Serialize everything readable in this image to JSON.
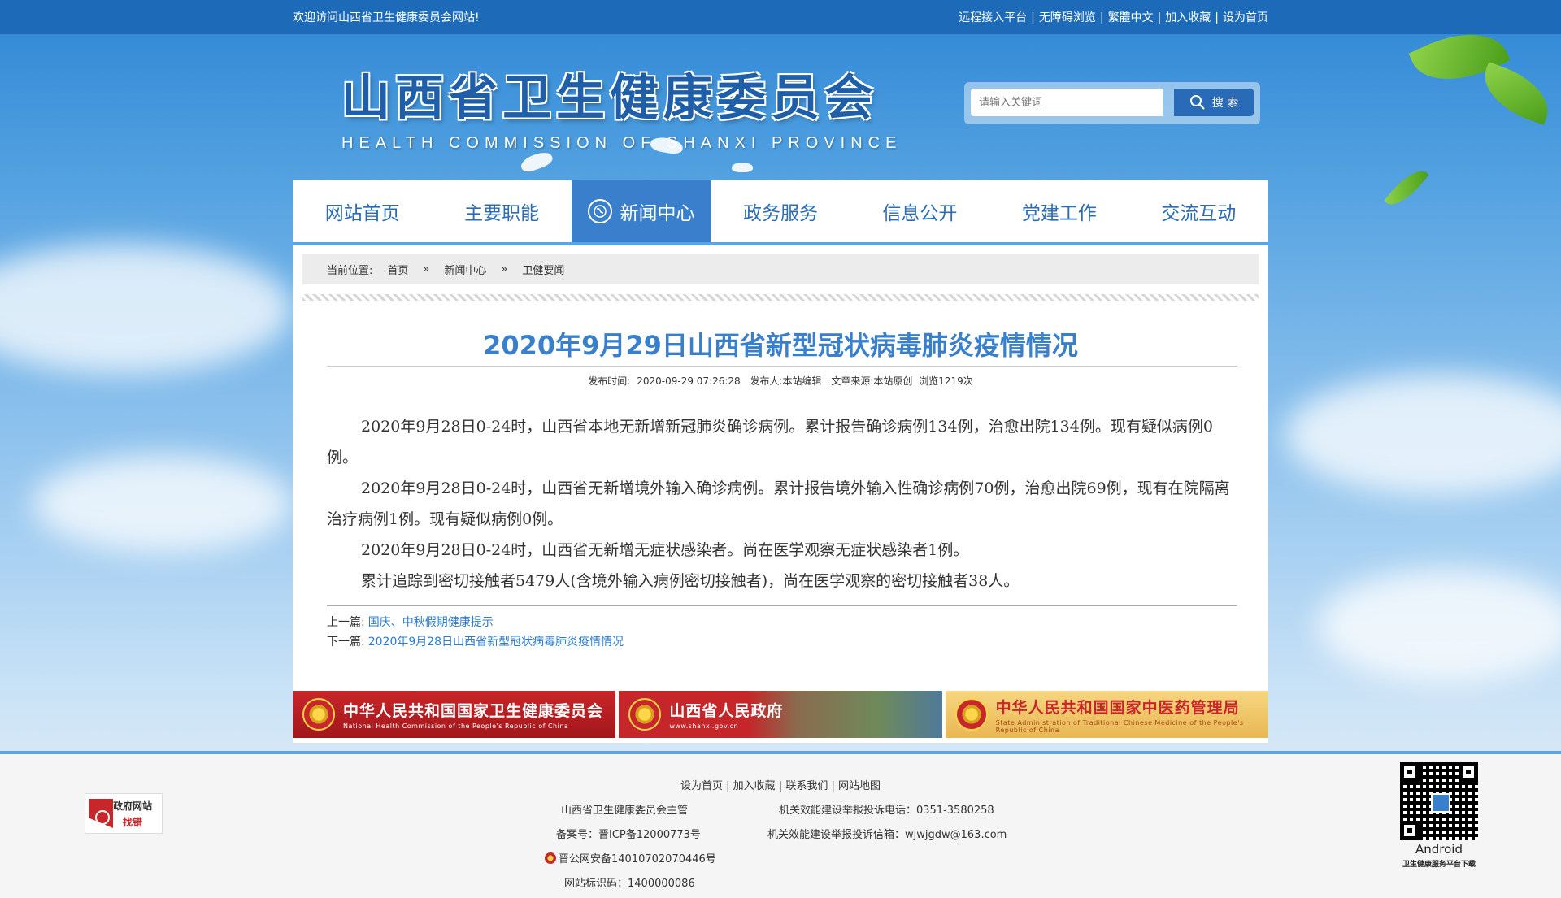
{
  "topbar": {
    "welcome": "欢迎访问山西省卫生健康委员会网站!",
    "links": [
      "远程接入平台",
      "无障碍浏览",
      "繁體中文",
      "加入收藏",
      "设为首页"
    ]
  },
  "logo": {
    "cn": "山西省卫生健康委员会",
    "en": "HEALTH COMMISSION OF SHANXI PROVINCE"
  },
  "search": {
    "placeholder": "请输入关键词",
    "button": "搜 索",
    "icon": "search-icon"
  },
  "nav": {
    "items": [
      "网站首页",
      "主要职能",
      "新闻中心",
      "政务服务",
      "信息公开",
      "党建工作",
      "交流互动"
    ],
    "active_index": 2
  },
  "breadcrumb": {
    "label": "当前位置:",
    "items": [
      "首页",
      "新闻中心",
      "卫健要闻"
    ],
    "separator": "»"
  },
  "article": {
    "title": "2020年9月29日山西省新型冠状病毒肺炎疫情情况",
    "meta": {
      "publish_time_label": "发布时间:",
      "publish_time": "2020-09-29 07:26:28",
      "publisher": "发布人:本站编辑",
      "source": "文章来源:本站原创",
      "views": "浏览1219次"
    },
    "paragraphs": [
      "2020年9月28日0-24时，山西省本地无新增新冠肺炎确诊病例。累计报告确诊病例134例，治愈出院134例。现有疑似病例0例。",
      "2020年9月28日0-24时，山西省无新增境外输入确诊病例。累计报告境外输入性确诊病例70例，治愈出院69例，现有在院隔离治疗病例1例。现有疑似病例0例。",
      "2020年9月28日0-24时，山西省无新增无症状感染者。尚在医学观察无症状感染者1例。",
      "累计追踪到密切接触者5479人(含境外输入病例密切接触者)，尚在医学观察的密切接触者38人。"
    ],
    "prev_label": "上一篇:",
    "prev_title": "国庆、中秋假期健康提示",
    "next_label": "下一篇:",
    "next_title": "2020年9月28日山西省新型冠状病毒肺炎疫情情况"
  },
  "banners": [
    {
      "cn": "中华人民共和国国家卫生健康委员会",
      "en": "National Health Commission of the People's Republic of China"
    },
    {
      "cn": "山西省人民政府",
      "en": "www.shanxi.gov.cn"
    },
    {
      "cn": "中华人民共和国国家中医药管理局",
      "en": "State Administration of Traditional Chinese Medicine of the People's Republic of China"
    }
  ],
  "footer": {
    "links": [
      "设为首页",
      "加入收藏",
      "联系我们",
      "网站地图"
    ],
    "sponsor": "山西省卫生健康委员会主管",
    "icp": "备案号：晋ICP备12000773号",
    "police": "晋公网安备14010702070446号",
    "site_code": "网站标识码：1400000086",
    "complaint_phone": "机关效能建设举报投诉电话：0351-3580258",
    "complaint_email": "机关效能建设举报投诉信箱：wjwjgdw@163.com",
    "badge_top": "政府网站",
    "badge_bottom": "找错",
    "qr_title": "Android",
    "qr_caption": "卫生健康服务平台下载"
  },
  "colors": {
    "brand_blue": "#3a7fcc",
    "link_blue": "#2b7cd0",
    "topbar": "#1d6bb8",
    "banner_red": "#c7262a"
  }
}
